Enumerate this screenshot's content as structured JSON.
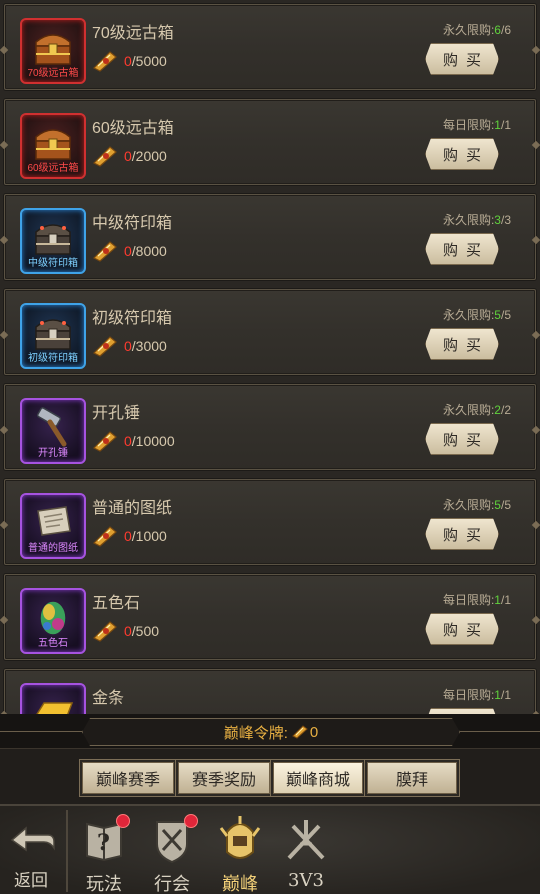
{
  "shop": {
    "buy_label": "购买",
    "items": [
      {
        "name": "70级远古箱",
        "tag": "70级远古箱",
        "quality": "red",
        "icon": "treasure-chest-icon",
        "have": "0",
        "need": "/5000",
        "limit_label": "永久限购:",
        "limit_cur": "6",
        "limit_max": "/6"
      },
      {
        "name": "60级远古箱",
        "tag": "60级远古箱",
        "quality": "red",
        "icon": "treasure-chest-icon",
        "have": "0",
        "need": "/2000",
        "limit_label": "每日限购:",
        "limit_cur": "1",
        "limit_max": "/1"
      },
      {
        "name": "中级符印箱",
        "tag": "中级符印箱",
        "quality": "blue",
        "icon": "rune-chest-icon",
        "have": "0",
        "need": "/8000",
        "limit_label": "永久限购:",
        "limit_cur": "3",
        "limit_max": "/3"
      },
      {
        "name": "初级符印箱",
        "tag": "初级符印箱",
        "quality": "blue",
        "icon": "rune-chest-icon",
        "have": "0",
        "need": "/3000",
        "limit_label": "永久限购:",
        "limit_cur": "5",
        "limit_max": "/5"
      },
      {
        "name": "开孔锤",
        "tag": "开孔锤",
        "quality": "purple",
        "icon": "hammer-icon",
        "have": "0",
        "need": "/10000",
        "limit_label": "永久限购:",
        "limit_cur": "2",
        "limit_max": "/2"
      },
      {
        "name": "普通的图纸",
        "tag": "普通的图纸",
        "quality": "purple",
        "icon": "scroll-icon",
        "have": "0",
        "need": "/1000",
        "limit_label": "永久限购:",
        "limit_cur": "5",
        "limit_max": "/5"
      },
      {
        "name": "五色石",
        "tag": "五色石",
        "quality": "purple",
        "icon": "gem-stone-icon",
        "have": "0",
        "need": "/500",
        "limit_label": "每日限购:",
        "limit_cur": "1",
        "limit_max": "/1"
      },
      {
        "name": "金条",
        "tag": "",
        "quality": "purple",
        "icon": "gold-bar-icon",
        "have": "",
        "need": "",
        "limit_label": "每日限购:",
        "limit_cur": "1",
        "limit_max": "/1"
      }
    ]
  },
  "token_bar": {
    "label": "巅峰令牌:",
    "value": "0",
    "icon": "token-icon"
  },
  "tabs": [
    {
      "label": "巅峰赛季",
      "active": false
    },
    {
      "label": "赛季奖励",
      "active": false
    },
    {
      "label": "巅峰商城",
      "active": true
    },
    {
      "label": "膜拜",
      "active": false
    }
  ],
  "nav": {
    "back_label": "返回",
    "items": [
      {
        "label": "玩法",
        "icon": "book-question-icon",
        "badge": true
      },
      {
        "label": "行会",
        "icon": "guild-shield-icon",
        "badge": true
      },
      {
        "label": "巅峰",
        "icon": "peak-helmet-icon",
        "badge": false,
        "active": true
      },
      {
        "label": "3V3",
        "icon": "crossed-swords-icon",
        "badge": false
      }
    ]
  },
  "colors": {
    "accent_gold": "#e8b042",
    "limit_green": "#5fd23c",
    "cost_red": "#ff3b2f",
    "quality_red": "#d03030",
    "quality_blue": "#3fa3e8",
    "quality_purple": "#a653e0"
  }
}
